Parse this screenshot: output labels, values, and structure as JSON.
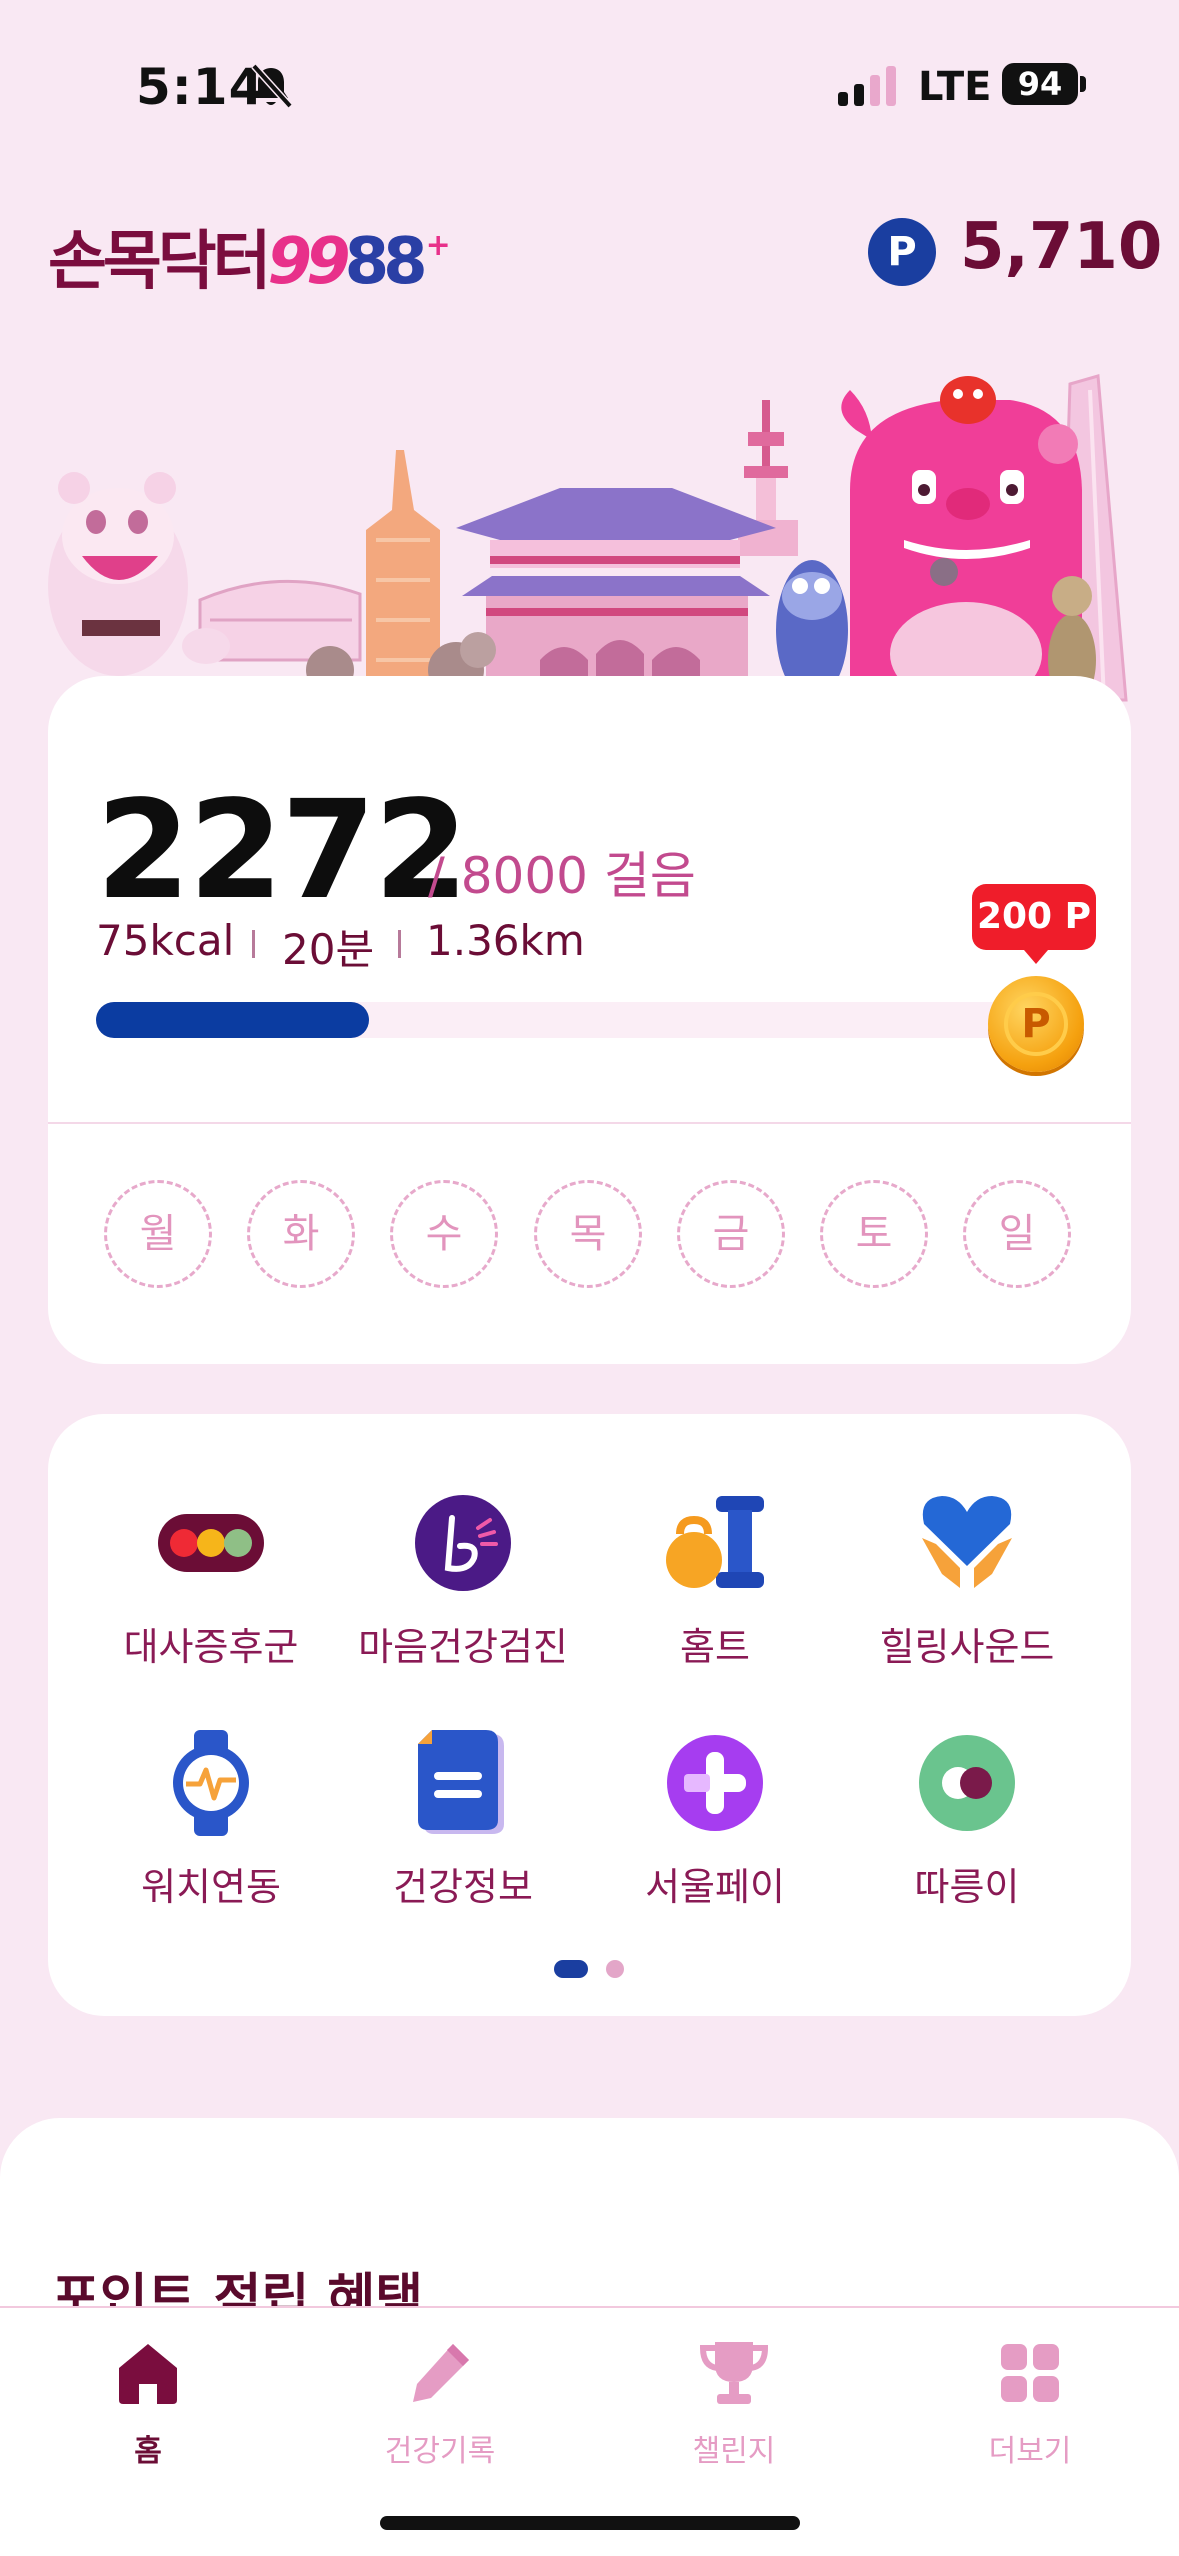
{
  "status": {
    "time": "5:14",
    "network": "LTE",
    "battery": "94"
  },
  "header": {
    "logo_main": "손목닥터",
    "logo_num_a": "99",
    "logo_num_b": "88",
    "logo_plus": "+",
    "points_symbol": "P",
    "points": "5,710"
  },
  "steps": {
    "count": "2272",
    "goal_text": "/ 8000 걸음",
    "kcal": "75kcal",
    "minutes": "20분",
    "distance": "1.36km",
    "progress": 0.284,
    "reward_label": "200 P",
    "coin_symbol": "P"
  },
  "week_days": [
    "월",
    "화",
    "수",
    "목",
    "금",
    "토",
    "일"
  ],
  "menu": {
    "items": [
      {
        "label": "대사증후군",
        "icon": "traffic-light-icon"
      },
      {
        "label": "마음건강검진",
        "icon": "mind-health-icon"
      },
      {
        "label": "홈트",
        "icon": "kettlebell-dumbbell-icon"
      },
      {
        "label": "힐링사운드",
        "icon": "heart-hands-icon"
      },
      {
        "label": "워치연동",
        "icon": "smartwatch-icon"
      },
      {
        "label": "건강정보",
        "icon": "document-icon"
      },
      {
        "label": "서울페이",
        "icon": "seoul-pay-icon"
      },
      {
        "label": "따릉이",
        "icon": "bike-share-icon"
      }
    ],
    "page": 1,
    "page_count": 2
  },
  "sheet": {
    "title": "포인트 적립 혜택"
  },
  "tabs": [
    {
      "label": "홈",
      "icon": "home-icon",
      "active": true
    },
    {
      "label": "건강기록",
      "icon": "pencil-icon",
      "active": false
    },
    {
      "label": "챌린지",
      "icon": "trophy-icon",
      "active": false
    },
    {
      "label": "더보기",
      "icon": "grid-icon",
      "active": false
    }
  ],
  "colors": {
    "brand": "#6b0d36",
    "accent": "#0b3ca1",
    "pink": "#e8308a",
    "background": "#f9e8f3"
  }
}
